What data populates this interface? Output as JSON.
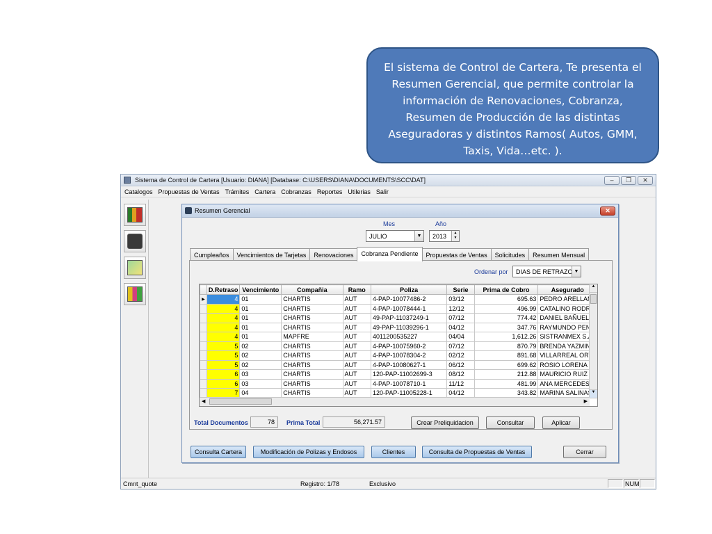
{
  "callout": {
    "text": "El sistema de Control de Cartera, Te presenta el Resumen Gerencial, que permite controlar la información  de  Renovaciones, Cobranza, Resumen de Producción de las distintas Aseguradoras y distintos Ramos( Autos, GMM, Taxis, Vida…etc. )."
  },
  "app": {
    "title": "Sistema de Control de Cartera   [Usuario: DIANA]     [Database: C:\\USERS\\DIANA\\DOCUMENTS\\SCC\\DAT]",
    "menu": [
      "Catalogos",
      "Propuestas de Ventas",
      "Trámites",
      "Cartera",
      "Cobranzas",
      "Reportes",
      "Utilerias",
      "Salir"
    ],
    "status": {
      "left": "Cmnt_quote",
      "registro": "Registro: 1/78",
      "mode": "Exclusivo",
      "num": "NUM"
    }
  },
  "dialog": {
    "title": "Resumen Gerencial",
    "mes_label": "Mes",
    "anio_label": "Año",
    "mes_value": "JULIO",
    "anio_value": "2013",
    "tabs": [
      "Cumpleaños",
      "Vencimientos de Tarjetas",
      "Renovaciones",
      "Cobranza Pendiente",
      "Propuestas de Ventas",
      "Solicitudes",
      "Resumen Mensual"
    ],
    "ordenar_label": "Ordenar por",
    "ordenar_value": "DIAS DE RETRAZO",
    "columns": [
      "D.Retraso",
      "Vencimiento",
      "Compañia",
      "Ramo",
      "Poliza",
      "Serie",
      "Prima de Cobro",
      "Asegurado"
    ],
    "rows": [
      [
        "4",
        "01",
        "CHARTIS",
        "AUT",
        "4-PAP-10077486-2",
        "03/12",
        "695.63",
        "PEDRO ARELLAN"
      ],
      [
        "4",
        "01",
        "CHARTIS",
        "AUT",
        "4-PAP-10078444-1",
        "12/12",
        "496.99",
        "CATALINO RODRI"
      ],
      [
        "4",
        "01",
        "CHARTIS",
        "AUT",
        "49-PAP-11037249-1",
        "07/12",
        "774.42",
        "DANIEL BAÑUELO"
      ],
      [
        "4",
        "01",
        "CHARTIS",
        "AUT",
        "49-PAP-11039296-1",
        "04/12",
        "347.76",
        "RAYMUNDO PENA"
      ],
      [
        "4",
        "01",
        "MAPFRE",
        "AUT",
        "4011200535227",
        "04/04",
        "1,612.26",
        "SISTRANMEX S.A."
      ],
      [
        "5",
        "02",
        "CHARTIS",
        "AUT",
        "4-PAP-10075960-2",
        "07/12",
        "870.79",
        "BRENDA YAZMIN"
      ],
      [
        "5",
        "02",
        "CHARTIS",
        "AUT",
        "4-PAP-10078304-2",
        "02/12",
        "891.68",
        "VILLARREAL ORTI"
      ],
      [
        "5",
        "02",
        "CHARTIS",
        "AUT",
        "4-PAP-10080627-1",
        "06/12",
        "699.62",
        "ROSIO LORENA B"
      ],
      [
        "6",
        "03",
        "CHARTIS",
        "AUT",
        "120-PAP-11002699-3",
        "08/12",
        "212.88",
        "MAURICIO RUIZ L"
      ],
      [
        "6",
        "03",
        "CHARTIS",
        "AUT",
        "4-PAP-10078710-1",
        "11/12",
        "481.99",
        "ANA MERCEDES F"
      ],
      [
        "7",
        "04",
        "CHARTIS",
        "AUT",
        "120-PAP-11005228-1",
        "04/12",
        "343.82",
        "MARINA SALINAS"
      ]
    ],
    "total_docs_label": "Total Documentos",
    "total_docs_value": "78",
    "prima_total_label": "Prima Total",
    "prima_total_value": "56,271.57",
    "btn_preliq": "Crear Preliquidacion",
    "btn_consultar": "Consultar",
    "btn_aplicar": "Aplicar",
    "btn_consulta_cartera": "Consulta Cartera",
    "btn_modificacion": "Modificación de Polizas y Endosos",
    "btn_clientes": "Clientes",
    "btn_consulta_propuestas": "Consulta de Propuestas de Ventas",
    "btn_cerrar": "Cerrar"
  },
  "colors": {
    "callout_bg": "#4f7ab9",
    "highlight": "#ffff00",
    "selected": "#3b8dde"
  }
}
